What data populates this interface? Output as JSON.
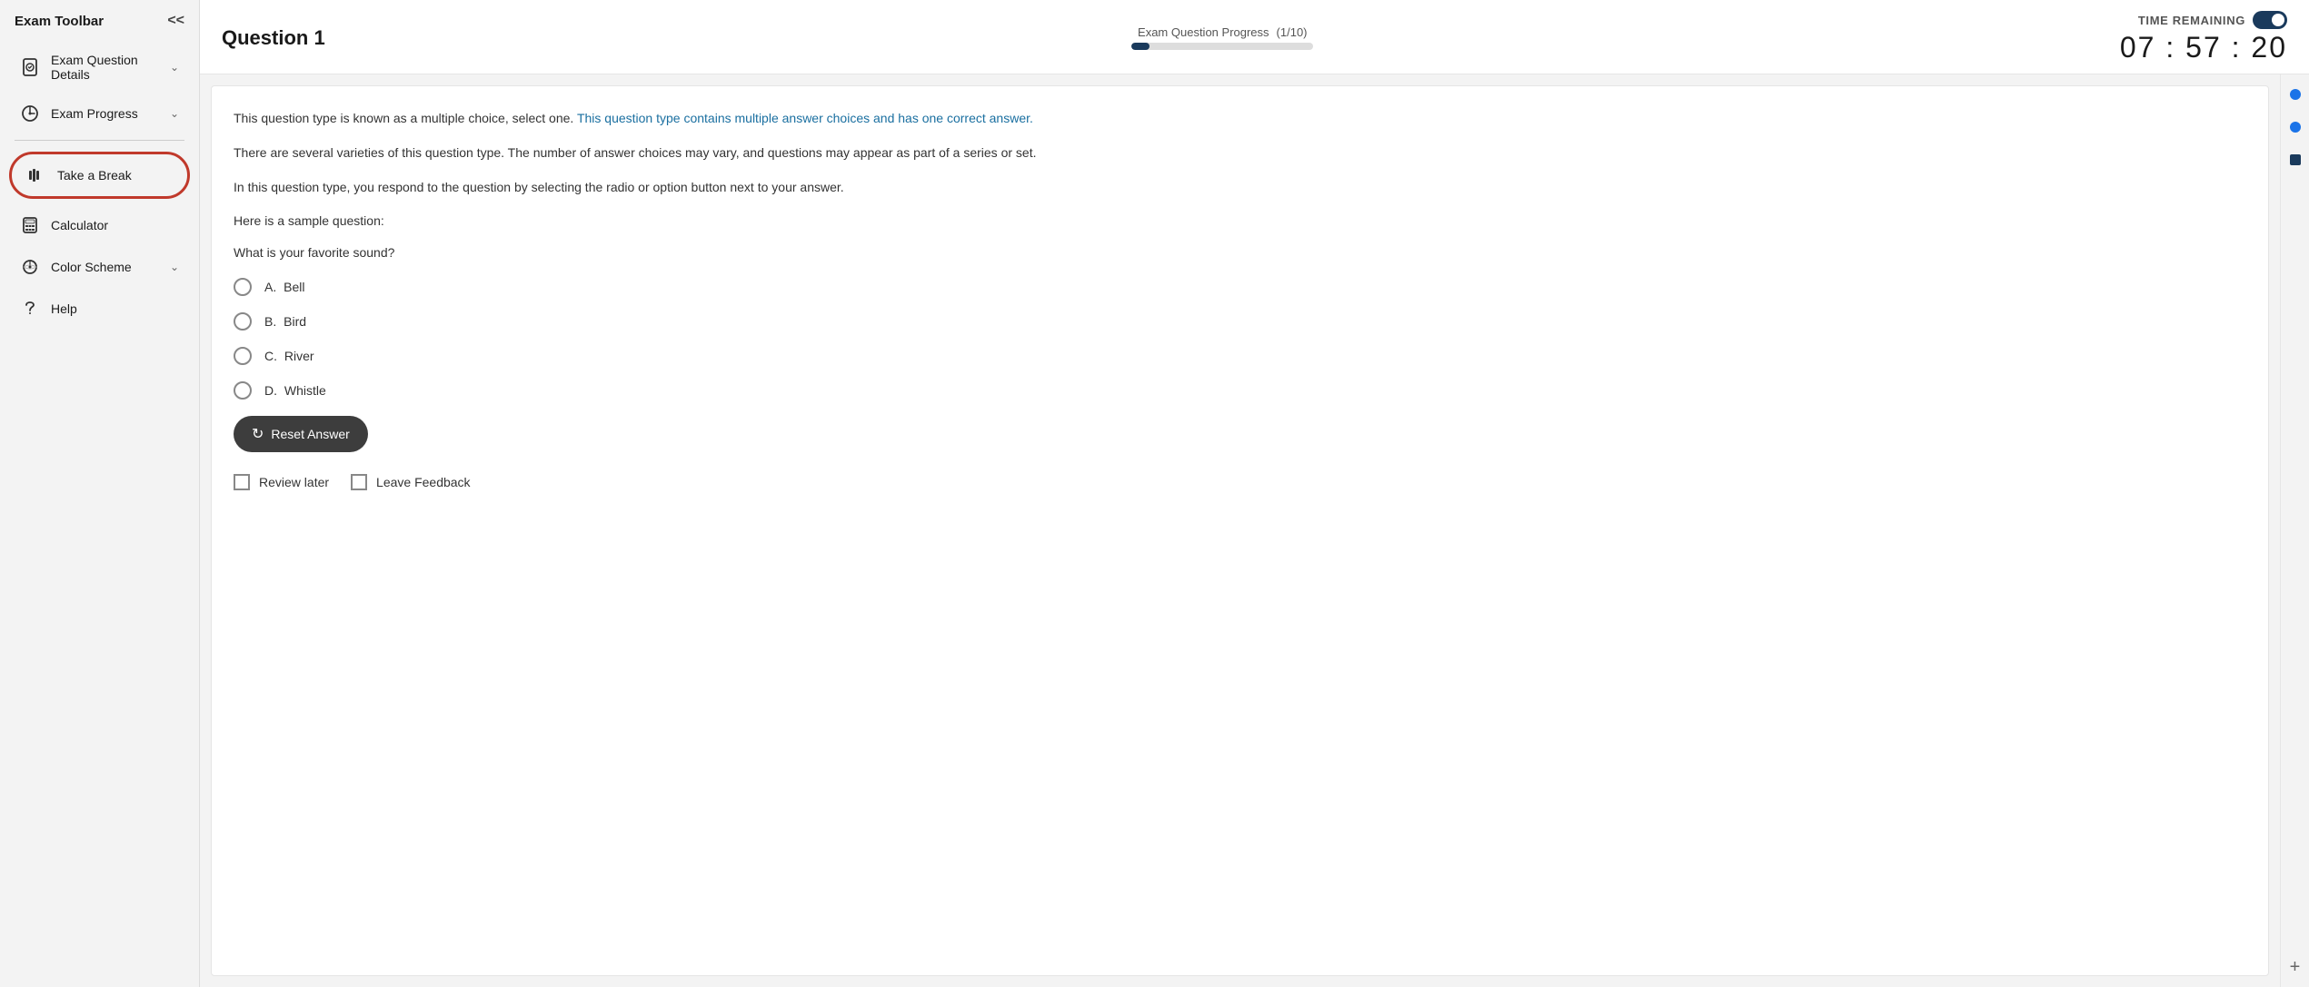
{
  "sidebar": {
    "title": "Exam Toolbar",
    "collapse_label": "<<",
    "items": [
      {
        "id": "exam-question-details",
        "label": "Exam Question Details",
        "has_chevron": true,
        "icon": "document-icon"
      },
      {
        "id": "exam-progress",
        "label": "Exam Progress",
        "has_chevron": true,
        "icon": "progress-icon"
      },
      {
        "id": "take-break",
        "label": "Take a Break",
        "has_chevron": false,
        "icon": "break-icon",
        "highlighted": true
      },
      {
        "id": "calculator",
        "label": "Calculator",
        "has_chevron": false,
        "icon": "calculator-icon"
      },
      {
        "id": "color-scheme",
        "label": "Color Scheme",
        "has_chevron": true,
        "icon": "colorscheme-icon"
      },
      {
        "id": "help",
        "label": "Help",
        "has_chevron": false,
        "icon": "help-icon"
      }
    ]
  },
  "header": {
    "question_title": "Question 1",
    "progress_label": "Exam Question Progress",
    "progress_count": "(1/10)",
    "progress_percent": 10,
    "timer_label": "TIME REMAINING",
    "timer_value": "07 : 57 : 20"
  },
  "content": {
    "description_1_plain": "This question type is known as a multiple choice, select one.",
    "description_1_highlight": "This question type contains multiple answer choices and has one correct answer.",
    "description_2": "There are several varieties of this question type. The number of answer choices may vary, and questions may appear as part of a series or set.",
    "description_3": "In this question type, you respond to the question by selecting the radio or option button next to your answer.",
    "sample_intro": "Here is a sample question:",
    "question_text": "What is your favorite sound?",
    "options": [
      {
        "letter": "A.",
        "text": "Bell"
      },
      {
        "letter": "B.",
        "text": "Bird"
      },
      {
        "letter": "C.",
        "text": "River"
      },
      {
        "letter": "D.",
        "text": "Whistle"
      }
    ],
    "reset_button_label": "Reset Answer",
    "review_later_label": "Review later",
    "leave_feedback_label": "Leave Feedback"
  },
  "right_sidebar": {
    "icons": [
      "dot-icon",
      "dot-icon-2",
      "dot-icon-3",
      "plus-icon"
    ]
  }
}
